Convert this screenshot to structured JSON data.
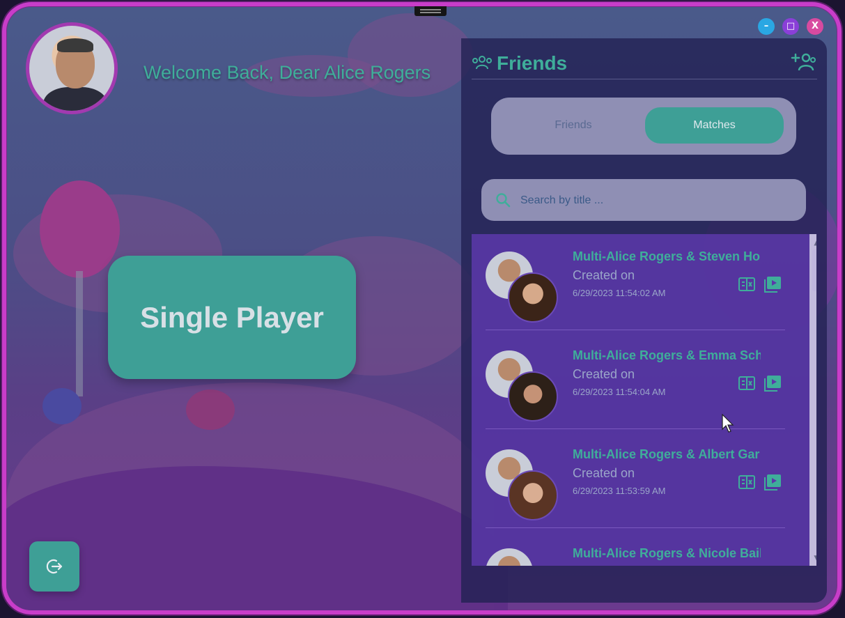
{
  "window": {
    "controls": {
      "minimize": "–",
      "maximize": "□",
      "close": "X"
    }
  },
  "welcome_text": "Welcome Back, Dear Alice Rogers",
  "single_player_label": "Single Player",
  "friends_panel": {
    "title": "Friends",
    "tabs": [
      {
        "label": "Friends",
        "active": false
      },
      {
        "label": "Matches",
        "active": true
      }
    ],
    "search": {
      "placeholder": "Search by title ...",
      "value": ""
    },
    "matches": [
      {
        "title": "Multi-Alice Rogers & Steven Ho",
        "created_label": "Created on",
        "date": "6/29/2023 11:54:02 AM"
      },
      {
        "title": "Multi-Alice Rogers & Emma Sch",
        "created_label": "Created on",
        "date": "6/29/2023 11:54:04 AM"
      },
      {
        "title": "Multi-Alice Rogers & Albert Gar",
        "created_label": "Created on",
        "date": "6/29/2023 11:53:59 AM"
      },
      {
        "title": "Multi-Alice Rogers & Nicole Bail",
        "created_label": "",
        "date": ""
      }
    ]
  },
  "colors": {
    "accent": "#3fae9a",
    "window_border": "#c83dc9",
    "panel_bg": "#232254",
    "list_bg": "#5c38aa"
  },
  "icons": {
    "header_left": "friends-group-icon",
    "header_right": "add-friend-icon",
    "search": "search-icon",
    "logout": "logout-icon",
    "match_action_1": "scoreboard-icon",
    "match_action_2": "play-video-icon"
  }
}
